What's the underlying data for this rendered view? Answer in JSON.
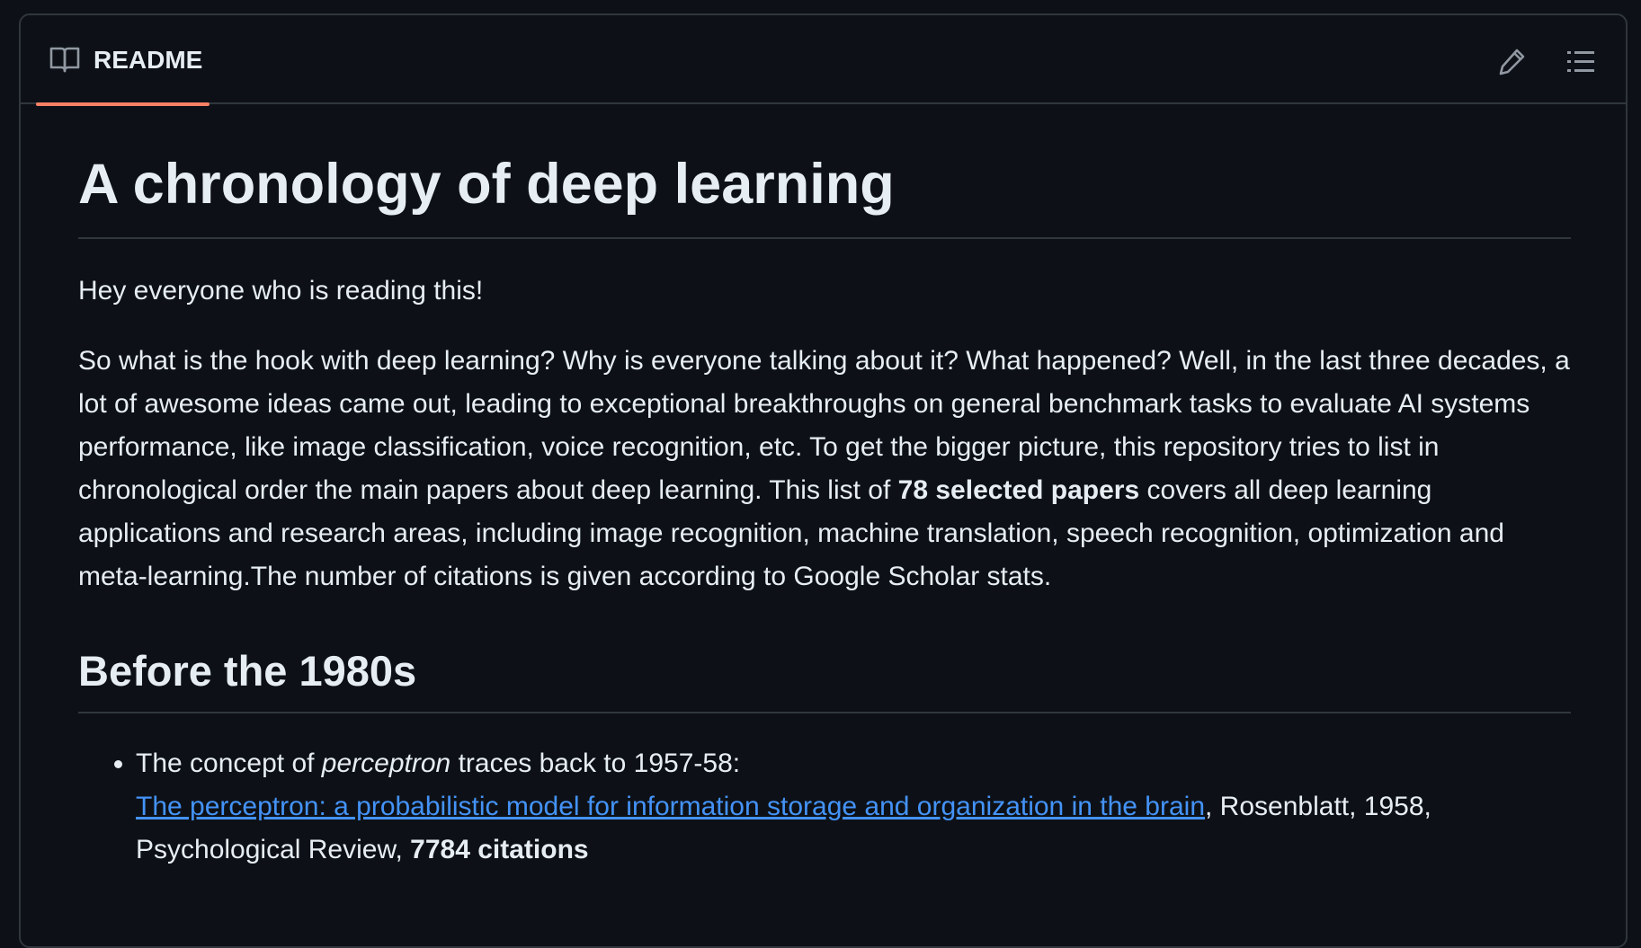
{
  "header": {
    "tab_label": "README",
    "tab_icon": "book-icon",
    "edit_icon": "pencil-icon",
    "outline_icon": "list-icon",
    "accent_color": "#f78166"
  },
  "content": {
    "title": "A chronology of deep learning",
    "greeting": "Hey everyone who is reading this!",
    "intro_before_bold": "So what is the hook with deep learning? Why is everyone talking about it? What happened? Well, in the last three decades, a lot of awesome ideas came out, leading to exceptional breakthroughs on general benchmark tasks to evaluate AI systems performance, like image classification, voice recognition, etc. To get the bigger picture, this repository tries to list in chronological order the main papers about deep learning. This list of ",
    "intro_bold": "78 selected papers",
    "intro_after_bold": " covers all deep learning applications and research areas, including image recognition, machine translation, speech recognition, optimization and meta-learning.The number of citations is given according to Google Scholar stats.",
    "section_title": "Before the 1980s",
    "list": [
      {
        "prefix": "The concept of ",
        "emphasis": "perceptron",
        "suffix": " traces back to 1957-58:",
        "link_text": "The perceptron: a probabilistic model for information storage and organization in the brain",
        "after_link": ", Rosenblatt, 1958, Psychological Review, ",
        "citations": "7784 citations"
      }
    ]
  },
  "colors": {
    "background": "#0d1117",
    "text": "#e6edf3",
    "border": "#30363d",
    "link": "#4493f8"
  }
}
